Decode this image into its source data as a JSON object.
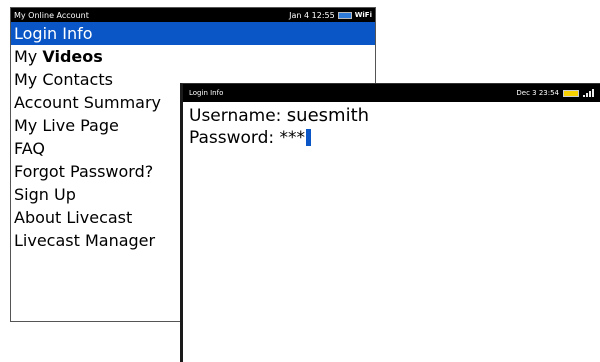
{
  "back_screen": {
    "status": {
      "title": "My Online Account",
      "datetime": "Jan 4 12:55",
      "network": "WiFi"
    },
    "menu": [
      {
        "label": "Login Info",
        "selected": true
      },
      {
        "label_prefix": "My ",
        "label_bold": "Videos"
      },
      {
        "label": "My Contacts"
      },
      {
        "label": "Account Summary"
      },
      {
        "label": "My Live Page"
      },
      {
        "label": "FAQ"
      },
      {
        "label": "Forgot Password?"
      },
      {
        "label": "Sign Up"
      },
      {
        "label": "About Livecast"
      },
      {
        "label": "Livecast Manager"
      }
    ]
  },
  "front_screen": {
    "status": {
      "title": "Login Info",
      "datetime": "Dec 3 23:54"
    },
    "username_label": "Username:",
    "username_value": "suesmith",
    "password_label": "Password:",
    "password_value": "***"
  }
}
